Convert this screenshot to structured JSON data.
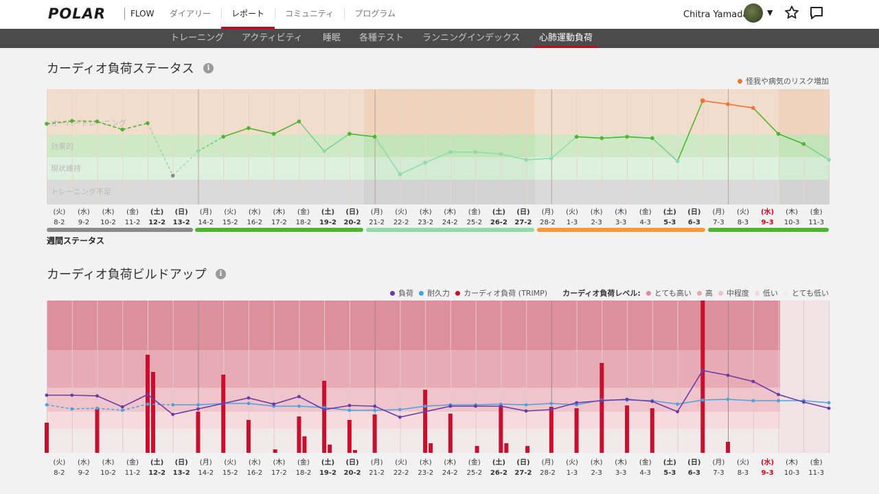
{
  "header": {
    "logo": "POLAR",
    "flow": "FLOW",
    "nav": [
      "ダイアリー",
      "レポート",
      "コミュニティ",
      "プログラム"
    ],
    "active_nav": "レポート",
    "user_name": "Chitra Yamada"
  },
  "subnav": {
    "items": [
      "トレーニング",
      "アクティビティ",
      "睡眠",
      "各種テスト",
      "ランニングインデックス",
      "心肺運動負荷"
    ],
    "active": "心肺運動負荷"
  },
  "status_section": {
    "title": "カーディオ負荷ステータス",
    "legend_risk": "怪我や病気のリスク増加",
    "zones": [
      "オーバートレーニング",
      "効果的",
      "現状維持",
      "トレーニング不足"
    ],
    "weekly_label": "週間ステータス"
  },
  "buildup_section": {
    "title": "カーディオ負荷ビルドアップ",
    "legend": {
      "load": "負荷",
      "tolerance": "耐久力",
      "trimp": "カーディオ負荷 (TRIMP)",
      "level_label": "カーディオ負荷レベル:",
      "levels": [
        "とても高い",
        "高",
        "中程度",
        "低い",
        "とても低い"
      ]
    }
  },
  "dates": [
    {
      "dow": "(火)",
      "date": "8-2",
      "bold": false,
      "red": false
    },
    {
      "dow": "(水)",
      "date": "9-2",
      "bold": false,
      "red": false
    },
    {
      "dow": "(木)",
      "date": "10-2",
      "bold": false,
      "red": false
    },
    {
      "dow": "(金)",
      "date": "11-2",
      "bold": false,
      "red": false
    },
    {
      "dow": "(土)",
      "date": "12-2",
      "bold": true,
      "red": false
    },
    {
      "dow": "(日)",
      "date": "13-2",
      "bold": true,
      "red": false
    },
    {
      "dow": "(月)",
      "date": "14-2",
      "bold": false,
      "red": false
    },
    {
      "dow": "(火)",
      "date": "15-2",
      "bold": false,
      "red": false
    },
    {
      "dow": "(水)",
      "date": "16-2",
      "bold": false,
      "red": false
    },
    {
      "dow": "(木)",
      "date": "17-2",
      "bold": false,
      "red": false
    },
    {
      "dow": "(金)",
      "date": "18-2",
      "bold": false,
      "red": false
    },
    {
      "dow": "(土)",
      "date": "19-2",
      "bold": true,
      "red": false
    },
    {
      "dow": "(日)",
      "date": "20-2",
      "bold": true,
      "red": false
    },
    {
      "dow": "(月)",
      "date": "21-2",
      "bold": false,
      "red": false
    },
    {
      "dow": "(火)",
      "date": "22-2",
      "bold": false,
      "red": false
    },
    {
      "dow": "(水)",
      "date": "23-2",
      "bold": false,
      "red": false
    },
    {
      "dow": "(木)",
      "date": "24-2",
      "bold": false,
      "red": false
    },
    {
      "dow": "(金)",
      "date": "25-2",
      "bold": false,
      "red": false
    },
    {
      "dow": "(土)",
      "date": "26-2",
      "bold": true,
      "red": false
    },
    {
      "dow": "(日)",
      "date": "27-2",
      "bold": true,
      "red": false
    },
    {
      "dow": "(月)",
      "date": "28-2",
      "bold": false,
      "red": false
    },
    {
      "dow": "(火)",
      "date": "1-3",
      "bold": false,
      "red": false
    },
    {
      "dow": "(水)",
      "date": "2-3",
      "bold": false,
      "red": false
    },
    {
      "dow": "(木)",
      "date": "3-3",
      "bold": false,
      "red": false
    },
    {
      "dow": "(金)",
      "date": "4-3",
      "bold": false,
      "red": false
    },
    {
      "dow": "(土)",
      "date": "5-3",
      "bold": true,
      "red": false
    },
    {
      "dow": "(日)",
      "date": "6-3",
      "bold": true,
      "red": false
    },
    {
      "dow": "(月)",
      "date": "7-3",
      "bold": false,
      "red": false
    },
    {
      "dow": "(火)",
      "date": "8-3",
      "bold": false,
      "red": false
    },
    {
      "dow": "(水)",
      "date": "9-3",
      "bold": true,
      "red": true
    },
    {
      "dow": "(木)",
      "date": "10-3",
      "bold": false,
      "red": false
    },
    {
      "dow": "(金)",
      "date": "11-3",
      "bold": false,
      "red": false
    }
  ],
  "colors": {
    "accent": "#d0021b",
    "status_green": "#4cb630",
    "status_light_green": "#8fdcaa",
    "status_grey": "#8a8a8a",
    "status_orange": "#f39a3a",
    "risk_orange": "#ee7733",
    "load_purple": "#6b3aa8",
    "tolerance_blue": "#4aa3e0",
    "trimp_red": "#c8102e"
  },
  "chart_data": [
    {
      "type": "line",
      "title": "カーディオ負荷ステータス",
      "zones": [
        "オーバートレーニング",
        "効果的",
        "現状維持",
        "トレーニング不足"
      ],
      "y_scale": "status level: 0 = bottom of トレーニング不足, 4 = top of オーバートレーニング",
      "values": [
        2.8,
        2.9,
        2.88,
        2.6,
        2.82,
        1.0,
        1.85,
        2.35,
        2.65,
        2.45,
        2.88,
        1.85,
        2.45,
        2.35,
        1.05,
        1.45,
        1.82,
        1.82,
        1.75,
        1.55,
        1.6,
        2.35,
        2.3,
        2.35,
        2.3,
        1.5,
        3.6,
        3.48,
        3.35,
        2.45,
        2.1,
        1.55
      ],
      "weekly_status": [
        "トレーニング不足",
        "効果的",
        "現状維持",
        "オーバートレーニング",
        "効果的"
      ]
    },
    {
      "type": "line",
      "title": "カーディオ負荷ビルドアップ",
      "series": [
        {
          "name": "負荷",
          "values": [
            84,
            84,
            83,
            67,
            85,
            56,
            64,
            72,
            80,
            71,
            82,
            63,
            69,
            68,
            52,
            60,
            68,
            68,
            68,
            61,
            63,
            73,
            76,
            78,
            75,
            60,
            120,
            113,
            104,
            85,
            74,
            65
          ]
        },
        {
          "name": "耐久力",
          "values": [
            70,
            64,
            65,
            62,
            71,
            70,
            70,
            72,
            72,
            68,
            68,
            66,
            62,
            62,
            63,
            68,
            70,
            70,
            71,
            70,
            72,
            70,
            77,
            77,
            76,
            71,
            77,
            78,
            76,
            76,
            76,
            73
          ]
        },
        {
          "name": "カーディオ負荷 (TRIMP)",
          "values": [
            44,
            0,
            64,
            0,
            143,
            0,
            60,
            114,
            48,
            0,
            53,
            105,
            48,
            56,
            0,
            92,
            57,
            0,
            69,
            0,
            67,
            65,
            131,
            69,
            65,
            0,
            222,
            16,
            0,
            0,
            0,
            0
          ]
        }
      ]
    }
  ]
}
